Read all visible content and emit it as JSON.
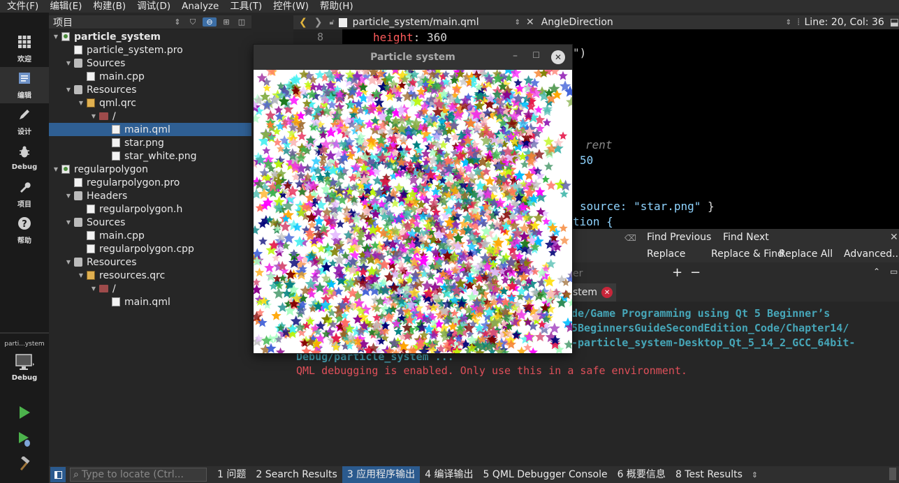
{
  "menu": [
    "文件(F)",
    "编辑(E)",
    "构建(B)",
    "调试(D)",
    "Analyze",
    "工具(T)",
    "控件(W)",
    "帮助(H)"
  ],
  "modes": [
    {
      "label": "欢迎",
      "icon": "grid-icon"
    },
    {
      "label": "编辑",
      "icon": "edit-doc-icon"
    },
    {
      "label": "设计",
      "icon": "pencil-icon"
    },
    {
      "label": "Debug",
      "icon": "bug-icon"
    },
    {
      "label": "项目",
      "icon": "wrench-icon"
    },
    {
      "label": "帮助",
      "icon": "help-icon"
    }
  ],
  "kit": {
    "project": "parti...ystem",
    "mode": "Debug"
  },
  "projects": {
    "title": "项目",
    "tree": [
      {
        "label": "particle_system",
        "depth": 0,
        "icon": "proj",
        "arrow": "down",
        "bold": true
      },
      {
        "label": "particle_system.pro",
        "depth": 1,
        "icon": "file"
      },
      {
        "label": "Sources",
        "depth": 1,
        "icon": "grp",
        "arrow": "down"
      },
      {
        "label": "main.cpp",
        "depth": 2,
        "icon": "file"
      },
      {
        "label": "Resources",
        "depth": 1,
        "icon": "grp",
        "arrow": "down"
      },
      {
        "label": "qml.qrc",
        "depth": 2,
        "icon": "qrc",
        "arrow": "down"
      },
      {
        "label": "/",
        "depth": 3,
        "icon": "folder",
        "arrow": "down"
      },
      {
        "label": "main.qml",
        "depth": 4,
        "icon": "file",
        "selected": true
      },
      {
        "label": "star.png",
        "depth": 4,
        "icon": "file"
      },
      {
        "label": "star_white.png",
        "depth": 4,
        "icon": "file"
      },
      {
        "label": "regularpolygon",
        "depth": 0,
        "icon": "proj",
        "arrow": "down"
      },
      {
        "label": "regularpolygon.pro",
        "depth": 1,
        "icon": "file"
      },
      {
        "label": "Headers",
        "depth": 1,
        "icon": "grp",
        "arrow": "down"
      },
      {
        "label": "regularpolygon.h",
        "depth": 2,
        "icon": "file"
      },
      {
        "label": "Sources",
        "depth": 1,
        "icon": "grp",
        "arrow": "down"
      },
      {
        "label": "main.cpp",
        "depth": 2,
        "icon": "file"
      },
      {
        "label": "regularpolygon.cpp",
        "depth": 2,
        "icon": "file"
      },
      {
        "label": "Resources",
        "depth": 1,
        "icon": "grp",
        "arrow": "down"
      },
      {
        "label": "resources.qrc",
        "depth": 2,
        "icon": "qrc",
        "arrow": "down"
      },
      {
        "label": "/",
        "depth": 3,
        "icon": "folder",
        "arrow": "down"
      },
      {
        "label": "main.qml",
        "depth": 4,
        "icon": "file"
      }
    ]
  },
  "editor": {
    "file": "particle_system/main.qml",
    "symbol": "AngleDirection",
    "position": "Line: 20, Col: 36",
    "line_number": "8",
    "code": {
      "l1_prop": "height",
      "l1_val": "360",
      "l2": "\")",
      "l3": "rent",
      "l4": "50",
      "l5_key": "source:",
      "l5_str": "\"star.png\"",
      "l5_end": "}",
      "l6": "tion {"
    }
  },
  "find": {
    "find_previous": "Find Previous",
    "find_next": "Find Next",
    "replace": "Replace",
    "replace_find": "Replace & Find",
    "replace_all": "Replace All",
    "advanced": "Advanced..."
  },
  "output": {
    "filter_partial": "er",
    "tab_partial": "stem",
    "lines": [
      "de/Game Programming using Qt 5 Beginner’s",
      "5BeginnersGuideSecondEdition_Code/Chapter14/",
      "-particle_system-Desktop_Qt_5_14_2_GCC_64bit-",
      "Debug/particle_system ..."
    ],
    "warning": "QML debugging is enabled. Only use this in a safe environment."
  },
  "particle_window": {
    "title": "Particle system",
    "colors": [
      "#e6194b",
      "#3cb44b",
      "#ffe119",
      "#4363d8",
      "#f58231",
      "#911eb4",
      "#46f0f0",
      "#f032e6",
      "#bcf60c",
      "#fabebe",
      "#008080",
      "#e6beff",
      "#9a6324",
      "#800000",
      "#aaffc3",
      "#808000",
      "#000075",
      "#1f7a1f",
      "#ff6f61",
      "#6b5b95",
      "#88b04b",
      "#d65076",
      "#45b8ac",
      "#5b5ea6",
      "#c0c0c0",
      "#2e8b57",
      "#ff00ff",
      "#00bfff",
      "#8b008b",
      "#ffa500"
    ]
  },
  "status": {
    "locator_placeholder": "Type to locate (Ctrl...",
    "tabs": [
      {
        "label": "1 问题"
      },
      {
        "label": "2 Search Results"
      },
      {
        "label": "3 应用程序输出",
        "active": true
      },
      {
        "label": "4 编译输出"
      },
      {
        "label": "5 QML Debugger Console"
      },
      {
        "label": "6 概要信息"
      },
      {
        "label": "8 Test Results"
      }
    ]
  }
}
